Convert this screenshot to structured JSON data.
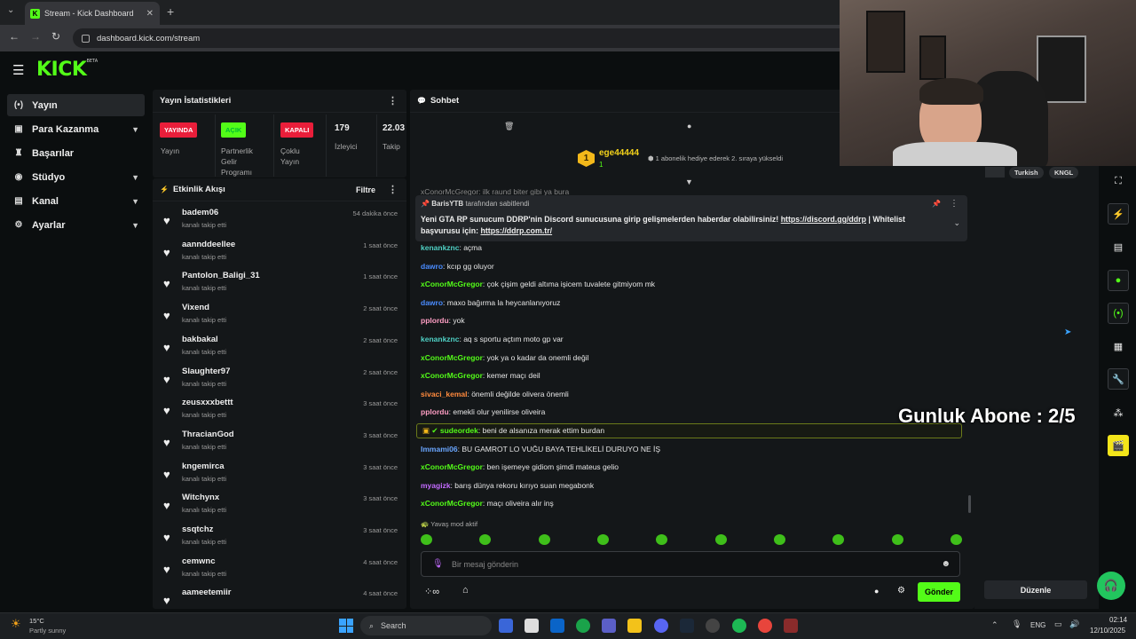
{
  "browser": {
    "tab_title": "Stream - Kick Dashboard",
    "url": "dashboard.kick.com/stream"
  },
  "logo": {
    "text": "KICK",
    "beta": "BETA"
  },
  "sidebar": {
    "items": [
      {
        "label": "Yayın",
        "icon": "broadcast-icon"
      },
      {
        "label": "Para Kazanma",
        "icon": "wallet-icon"
      },
      {
        "label": "Başarılar",
        "icon": "trophy-icon"
      },
      {
        "label": "Stüdyo",
        "icon": "studio-icon"
      },
      {
        "label": "Kanal",
        "icon": "channel-icon"
      },
      {
        "label": "Ayarlar",
        "icon": "gear-icon"
      }
    ]
  },
  "stats": {
    "title": "Yayın İstatistikleri",
    "live_badge": "YAYINDA",
    "live_label": "Yayın",
    "partner_badge": "AÇIK",
    "partner_label_1": "Partnerlik",
    "partner_label_2": "Gelir",
    "partner_label_3": "Programı",
    "multi_badge": "KAPALI",
    "multi_label_1": "Çoklu",
    "multi_label_2": "Yayın",
    "viewers_value": "179",
    "viewers_label": "İzleyici",
    "followers_value": "22.03",
    "followers_label": "Takip"
  },
  "feed": {
    "title": "Etkinlik Akışı",
    "filter": "Filtre",
    "events": [
      {
        "name": "badem06",
        "sub": "kanalı takip etti",
        "time": "54 dakika önce"
      },
      {
        "name": "aannddeellee",
        "sub": "kanalı takip etti",
        "time": "1 saat önce"
      },
      {
        "name": "Pantolon_Baligi_31",
        "sub": "kanalı takip etti",
        "time": "1 saat önce"
      },
      {
        "name": "Vixend",
        "sub": "kanalı takip etti",
        "time": "2 saat önce"
      },
      {
        "name": "bakbakal",
        "sub": "kanalı takip etti",
        "time": "2 saat önce"
      },
      {
        "name": "Slaughter97",
        "sub": "kanalı takip etti",
        "time": "2 saat önce"
      },
      {
        "name": "zeusxxxbettt",
        "sub": "kanalı takip etti",
        "time": "3 saat önce"
      },
      {
        "name": "ThracianGod",
        "sub": "kanalı takip etti",
        "time": "3 saat önce"
      },
      {
        "name": "kngemirca",
        "sub": "kanalı takip etti",
        "time": "3 saat önce"
      },
      {
        "name": "Witchynx",
        "sub": "kanalı takip etti",
        "time": "3 saat önce"
      },
      {
        "name": "ssqtchz",
        "sub": "kanalı takip etti",
        "time": "3 saat önce"
      },
      {
        "name": "cemwnc",
        "sub": "kanalı takip etti",
        "time": "4 saat önce"
      },
      {
        "name": "aameetemiir",
        "sub": "",
        "time": "4 saat önce"
      }
    ]
  },
  "chat": {
    "title": "Sohbet",
    "gift": {
      "rank": "1",
      "user": "ege44444",
      "count": "1",
      "text": "1 abonelik hediye ederek 2. sıraya yükseldi"
    },
    "top_partial": "xConorMcGregor: ilk raund biter gibi ya bura",
    "pinned": {
      "by_user": "BarisYTB",
      "by_text": "tarafından sabitlendi",
      "text_1": "Yeni GTA RP sunucum DDRP'nin Discord sunucusuna girip gelişmelerden haberdar olabilirsiniz! ",
      "link_1": "https://discord.gg/ddrp",
      "text_2": " | Whitelist",
      "text_3": "başvurusu için: ",
      "link_2": "https://ddrp.com.tr/"
    },
    "messages": [
      {
        "user": "kenankznc",
        "color": "#4fd1c5",
        "text": "açma"
      },
      {
        "user": "dawro",
        "color": "#4a8cff",
        "text": "kcıp gg oluyor"
      },
      {
        "user": "xConorMcGregor",
        "color": "#53fc18",
        "text": "çok çişim geldi altıma işicem tuvalete gitmiyom mk"
      },
      {
        "user": "dawro",
        "color": "#4a8cff",
        "text": "maxo bağırma la heycanlanıyoruz"
      },
      {
        "user": "pplordu",
        "color": "#ff9ec4",
        "text": "yok"
      },
      {
        "user": "kenankznc",
        "color": "#4fd1c5",
        "text": "aq s sportu açtım moto gp var"
      },
      {
        "user": "xConorMcGregor",
        "color": "#53fc18",
        "text": "yok ya o kadar da onemli değil"
      },
      {
        "user": "xConorMcGregor",
        "color": "#53fc18",
        "text": "kemer maçı deil"
      },
      {
        "user": "sivaci_kemal",
        "color": "#ff8a3d",
        "text": "önemli değilde olivera önemli"
      },
      {
        "user": "pplordu",
        "color": "#ff9ec4",
        "text": "emekli olur yenilirse oliveira"
      },
      {
        "user": "sudeordek",
        "color": "#53fc18",
        "text": "beni de alsanıza merak ettim burdan"
      },
      {
        "user": "Immami06",
        "color": "#6aa6ff",
        "text": "BU GAMROT LO VUĞU BAYA TEHLİKELİ DURUYO NE İŞ"
      },
      {
        "user": "xConorMcGregor",
        "color": "#53fc18",
        "text": "ben işemeye gidiom şimdi mateus gelio"
      },
      {
        "user": "myagizk",
        "color": "#c36bff",
        "text": "barış dünya rekoru kırıyo suan megabonk"
      },
      {
        "user": "xConorMcGregor",
        "color": "#53fc18",
        "text": "maçı oliveira alır inş"
      }
    ],
    "slow_mode": "Yavaş mod aktif",
    "input_placeholder": "Bir mesaj gönderin",
    "send": "Gönder"
  },
  "overlay": {
    "subs_text": "Gunluk Abone : 2/5",
    "tag_1": "Turkish",
    "tag_2": "KNGL",
    "edit": "Düzenle"
  },
  "taskbar": {
    "temp": "15°C",
    "weather": "Partly sunny",
    "search": "Search",
    "lang": "ENG",
    "time": "02:14",
    "date": "12/10/2025"
  }
}
